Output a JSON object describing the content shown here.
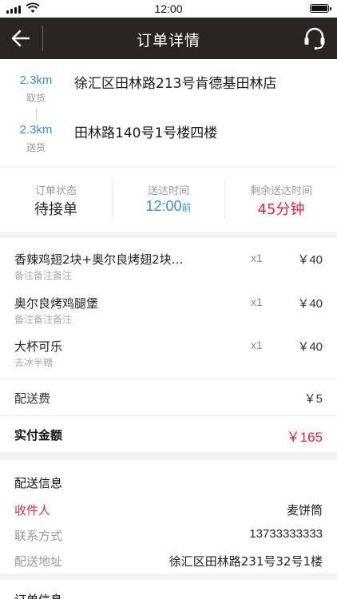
{
  "statusbar": {
    "time": "12:00"
  },
  "navbar": {
    "title": "订单详情"
  },
  "address": {
    "pickup": {
      "distance": "2.3km",
      "tag": "取货",
      "address": "徐汇区田林路213号肯德基田林店"
    },
    "dropoff": {
      "distance": "2.3km",
      "tag": "送货",
      "address": "田林路140号1号楼四楼"
    }
  },
  "status": {
    "order_state": {
      "label": "订单状态",
      "value": "待接单"
    },
    "delivery_time": {
      "label": "送达时间",
      "value": "12:00",
      "suffix": "前"
    },
    "remaining": {
      "label": "剩余送达时间",
      "value": "45分钟"
    }
  },
  "items": [
    {
      "name": "香辣鸡翅2块+奥尔良烤翅2块…",
      "note": "备注备注备注",
      "qty": "x1",
      "price": "￥40"
    },
    {
      "name": "奥尔良烤鸡腿堡",
      "note": "备注备注备注",
      "qty": "x1",
      "price": "￥40"
    },
    {
      "name": "大杯可乐",
      "note": "去冰半糖",
      "qty": "x1",
      "price": "￥40"
    }
  ],
  "fee": {
    "label": "配送费",
    "value": "￥5"
  },
  "total": {
    "label": "实付金额",
    "value": "￥165"
  },
  "delivery": {
    "title": "配送信息",
    "receiver": {
      "label": "收件人",
      "value": "麦饼筒"
    },
    "phone": {
      "label": "联系方式",
      "value": "13733333333"
    },
    "address": {
      "label": "配送地址",
      "value": "徐汇区田林路231号32号1楼"
    }
  },
  "next_section": {
    "title": "订单信息"
  },
  "colors": {
    "navbar": "#2a2523",
    "accent_blue": "#3a8fd6",
    "accent_red": "#e0243a"
  },
  "icons": {
    "back": "arrow-left-icon",
    "service": "headset-icon"
  }
}
